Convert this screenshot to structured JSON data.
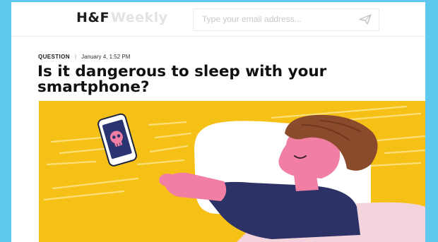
{
  "header": {
    "logo_primary": "H&F",
    "logo_secondary": "Weekly",
    "email_placeholder": "Type your email address...",
    "send_icon": "paper-plane-icon"
  },
  "article": {
    "category": "QUESTION",
    "separator": "|",
    "date": "January 4, 1:52 PM",
    "title": "Is it dangerous to sleep with your smartphone?"
  },
  "illustration": {
    "description_icons": [
      "smartphone-icon",
      "skull-icon"
    ],
    "background_color": "#f5c116"
  },
  "colors": {
    "accent_blue": "#5fc8ef",
    "hero_yellow": "#f5c116",
    "skin_pink": "#f07fa3",
    "shirt_navy": "#2c3266"
  }
}
